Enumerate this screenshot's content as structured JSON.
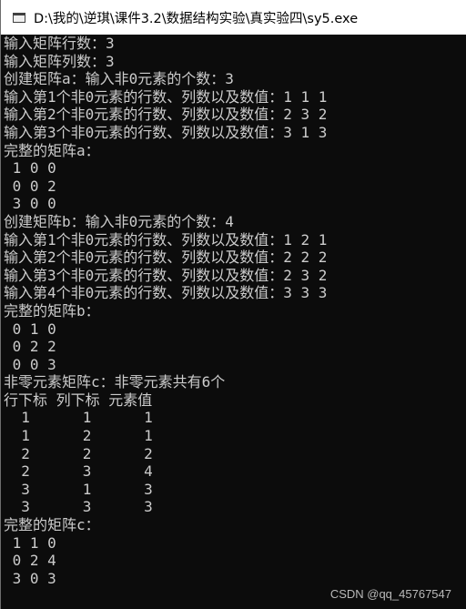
{
  "window": {
    "title": "D:\\我的\\逆琪\\课件3.2\\数据结构实验\\真实验四\\sy5.exe",
    "icon": "console-window-icon"
  },
  "console": {
    "lines": [
      "输入矩阵行数：3",
      "输入矩阵列数：3",
      "创建矩阵a：输入非0元素的个数：3",
      "输入第1个非0元素的行数、列数以及数值：1 1 1",
      "输入第2个非0元素的行数、列数以及数值：2 3 2",
      "输入第3个非0元素的行数、列数以及数值：3 1 3",
      "完整的矩阵a：",
      " 1 0 0",
      " 0 0 2",
      " 3 0 0",
      "创建矩阵b：输入非0元素的个数：4",
      "输入第1个非0元素的行数、列数以及数值：1 2 1",
      "输入第2个非0元素的行数、列数以及数值：2 2 2",
      "输入第3个非0元素的行数、列数以及数值：2 3 2",
      "输入第4个非0元素的行数、列数以及数值：3 3 3",
      "完整的矩阵b：",
      " 0 1 0",
      " 0 2 2",
      " 0 0 3",
      "非零元素矩阵c：非零元素共有6个",
      "行下标 列下标 元素值",
      "  1      1      1",
      "  1      2      1",
      "  2      2      2",
      "  2      3      4",
      "  3      1      3",
      "  3      3      3",
      "完整的矩阵c：",
      " 1 1 0",
      " 0 2 4",
      " 3 0 3"
    ]
  },
  "watermark": "CSDN @qq_45767547",
  "colors": {
    "console_bg": "#0c0c0c",
    "console_text": "#cccccc",
    "titlebar_bg": "#ffffff",
    "title_text": "#000000"
  }
}
